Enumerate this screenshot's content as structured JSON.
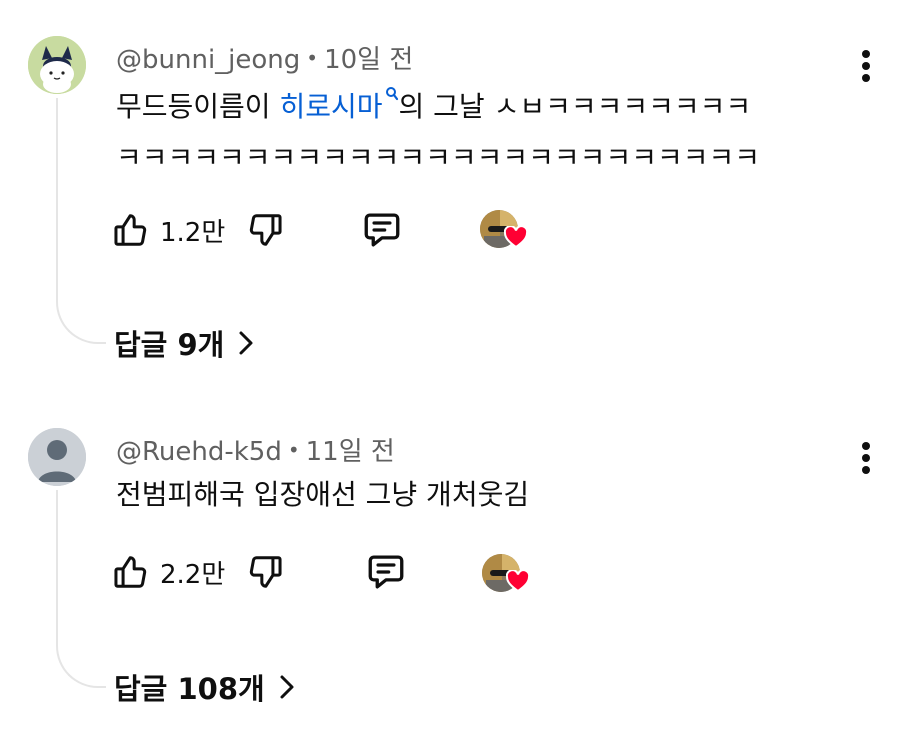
{
  "comments": [
    {
      "author": "@bunni_jeong",
      "age": "10일 전",
      "text_before_link": "무드등이름이 ",
      "link_text": "히로시마",
      "text_after_link": "의 그날 ㅅㅂㅋㅋㅋㅋㅋㅋㅋㅋ",
      "text_line2": "ㅋㅋㅋㅋㅋㅋㅋㅋㅋㅋㅋㅋㅋㅋㅋㅋㅋㅋㅋㅋㅋㅋㅋㅋㅋ",
      "likes": "1.2만",
      "replies_label": "답글 9개"
    },
    {
      "author": "@Ruehd-k5d",
      "age": "11일 전",
      "text": "전범피해국 입장애선 그냥 개처웃김",
      "likes": "2.2만",
      "replies_label": "답글 108개"
    }
  ],
  "separator": "•",
  "colors": {
    "link": "#065fd4",
    "meta": "#606060",
    "heart": "#ff0033",
    "thread_line": "#e5e5e5"
  },
  "icons": [
    "thumbs-up-icon",
    "thumbs-down-icon",
    "reply-icon",
    "more-vert-icon",
    "heart-icon",
    "chevron-right-icon",
    "search-icon"
  ]
}
